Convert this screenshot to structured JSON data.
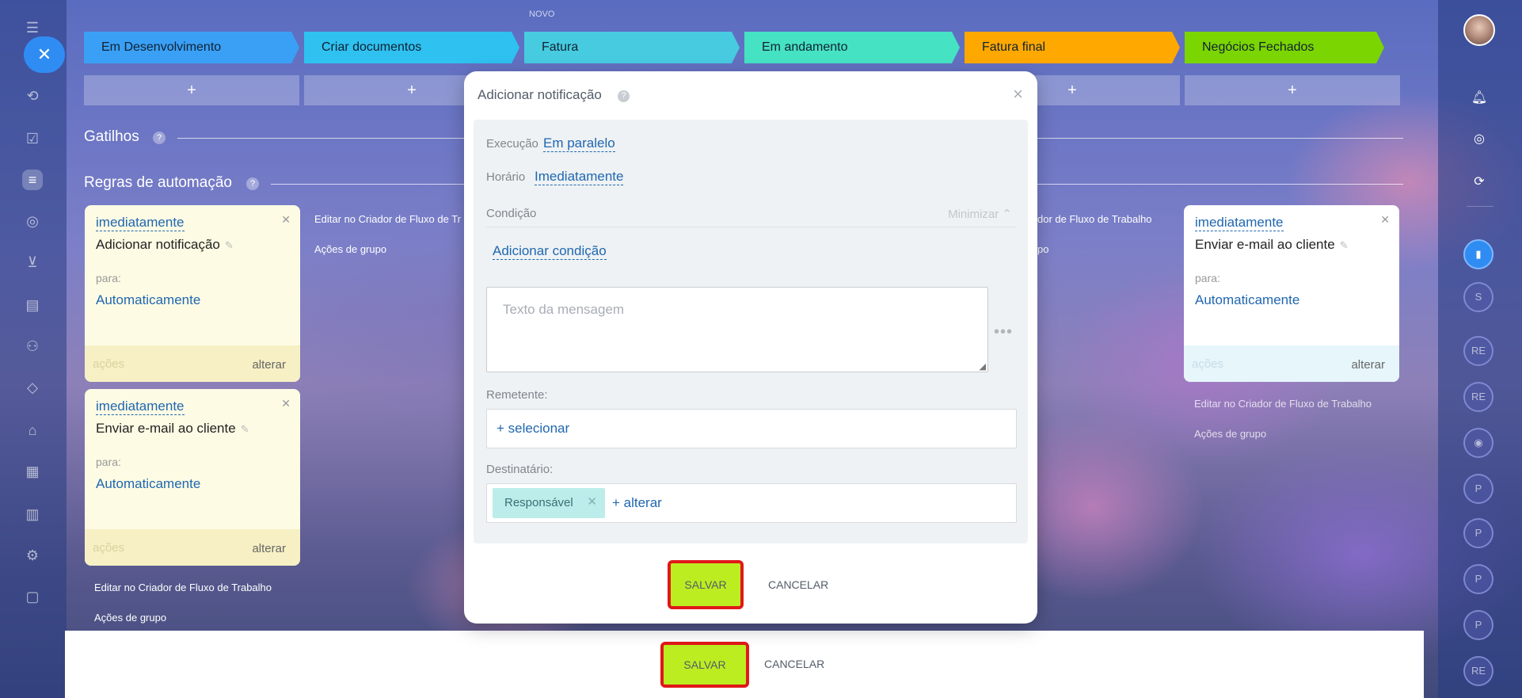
{
  "header": {
    "novo_label": "NOVO"
  },
  "stages": [
    {
      "label": "Em Desenvolvimento",
      "color": "#3aa0f5"
    },
    {
      "label": "Criar documentos",
      "color": "#2fc1f0"
    },
    {
      "label": "Fatura",
      "color": "#47cbe0"
    },
    {
      "label": "Em andamento",
      "color": "#46e2c4"
    },
    {
      "label": "Fatura final",
      "color": "#ffa800"
    },
    {
      "label": "Negócios Fechados",
      "color": "#7bd500"
    }
  ],
  "plus_symbol": "+",
  "sections": {
    "triggers": "Gatilhos",
    "rules": "Regras de automação",
    "help": "?"
  },
  "cards": {
    "left_top": {
      "when": "imediatamente",
      "name": "Adicionar notificação",
      "para": "para:",
      "target": "Automaticamente",
      "acoes": "ações",
      "alterar": "alterar"
    },
    "left_bottom": {
      "when": "imediatamente",
      "name": "Enviar e-mail ao cliente",
      "para": "para:",
      "target": "Automaticamente",
      "acoes": "ações",
      "alterar": "alterar"
    },
    "right": {
      "when": "imediatamente",
      "name": "Enviar e-mail ao cliente",
      "para": "para:",
      "target": "Automaticamente",
      "acoes": "ações",
      "alterar": "alterar"
    }
  },
  "links": {
    "edit_workflow": "Editar no Criador de Fluxo de Trabalho",
    "edit_workflow_cut": "Editar no Criador de Fluxo de Tr",
    "edit_workflow_cut2": "dor de Fluxo de Trabalho",
    "group_actions": "Ações de grupo",
    "group_actions_cut": "po"
  },
  "modal": {
    "title": "Adicionar notificação",
    "help": "?",
    "close": "×",
    "execution_label": "Execução",
    "execution_value": "Em paralelo",
    "schedule_label": "Horário",
    "schedule_value": "Imediatamente",
    "condition_label": "Condição",
    "minimize": "Minimizar",
    "add_condition": "Adicionar condição",
    "message_placeholder": "Texto da mensagem",
    "more": "•••",
    "sender_label": "Remetente:",
    "sender_select": "+ selecionar",
    "recipient_label": "Destinatário:",
    "recipient_tag": "Responsável",
    "recipient_change": "+ alterar",
    "save": "SALVAR",
    "cancel": "CANCELAR"
  },
  "bottom": {
    "save": "SALVAR",
    "cancel": "CANCELAR"
  },
  "right_rail": {
    "circles": [
      "S",
      "RE",
      "RE",
      "P",
      "P",
      "P",
      "P",
      "RE"
    ]
  }
}
